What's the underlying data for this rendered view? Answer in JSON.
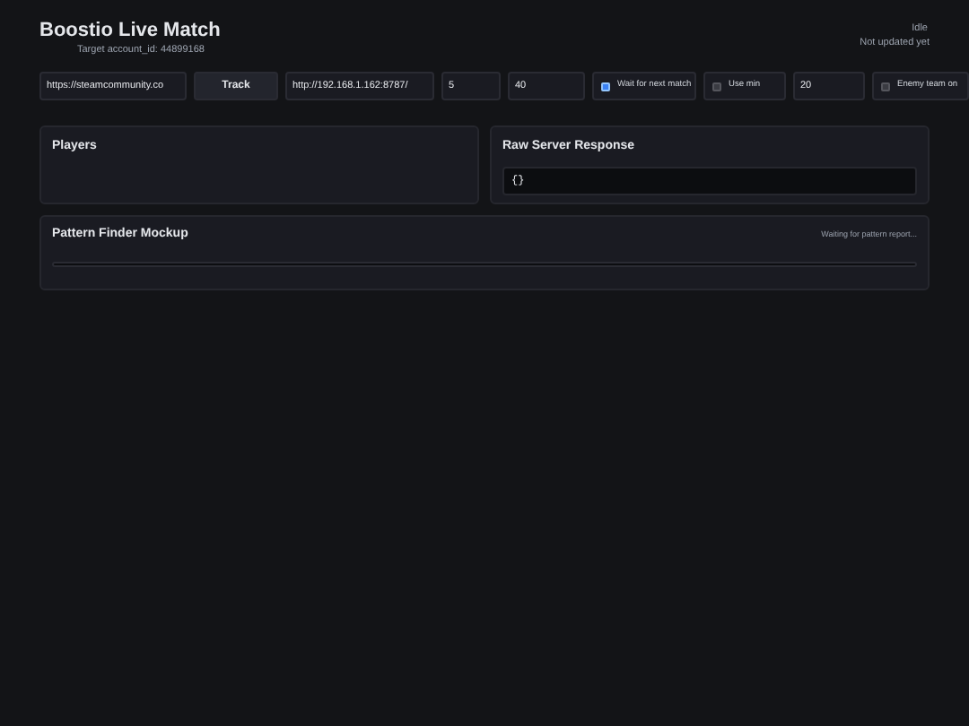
{
  "header": {
    "title": "Boostio Live Match",
    "subtitle": "Target account_id: 44899168",
    "status": "Idle",
    "updated": "Not updated yet"
  },
  "controls": [
    {
      "kind": "input",
      "value": "https://steamcommunity.co"
    },
    {
      "kind": "button",
      "label": "Track"
    },
    {
      "kind": "input",
      "value": "http://192.168.1.162:8787/"
    },
    {
      "kind": "input",
      "value": "5"
    },
    {
      "kind": "input",
      "value": "40"
    },
    {
      "kind": "checkbox",
      "label": "Wait for next match",
      "checked": true
    },
    {
      "kind": "checkbox",
      "label": "Use min",
      "checked": false
    },
    {
      "kind": "input",
      "value": "20"
    },
    {
      "kind": "checkbox",
      "label": "Enemy team on",
      "checked": false
    }
  ],
  "players": {
    "title": "Players"
  },
  "raw": {
    "title": "Raw Server Response",
    "body": "{}"
  },
  "pattern": {
    "title": "Pattern Finder Mockup",
    "status": "Waiting for pattern report..."
  }
}
